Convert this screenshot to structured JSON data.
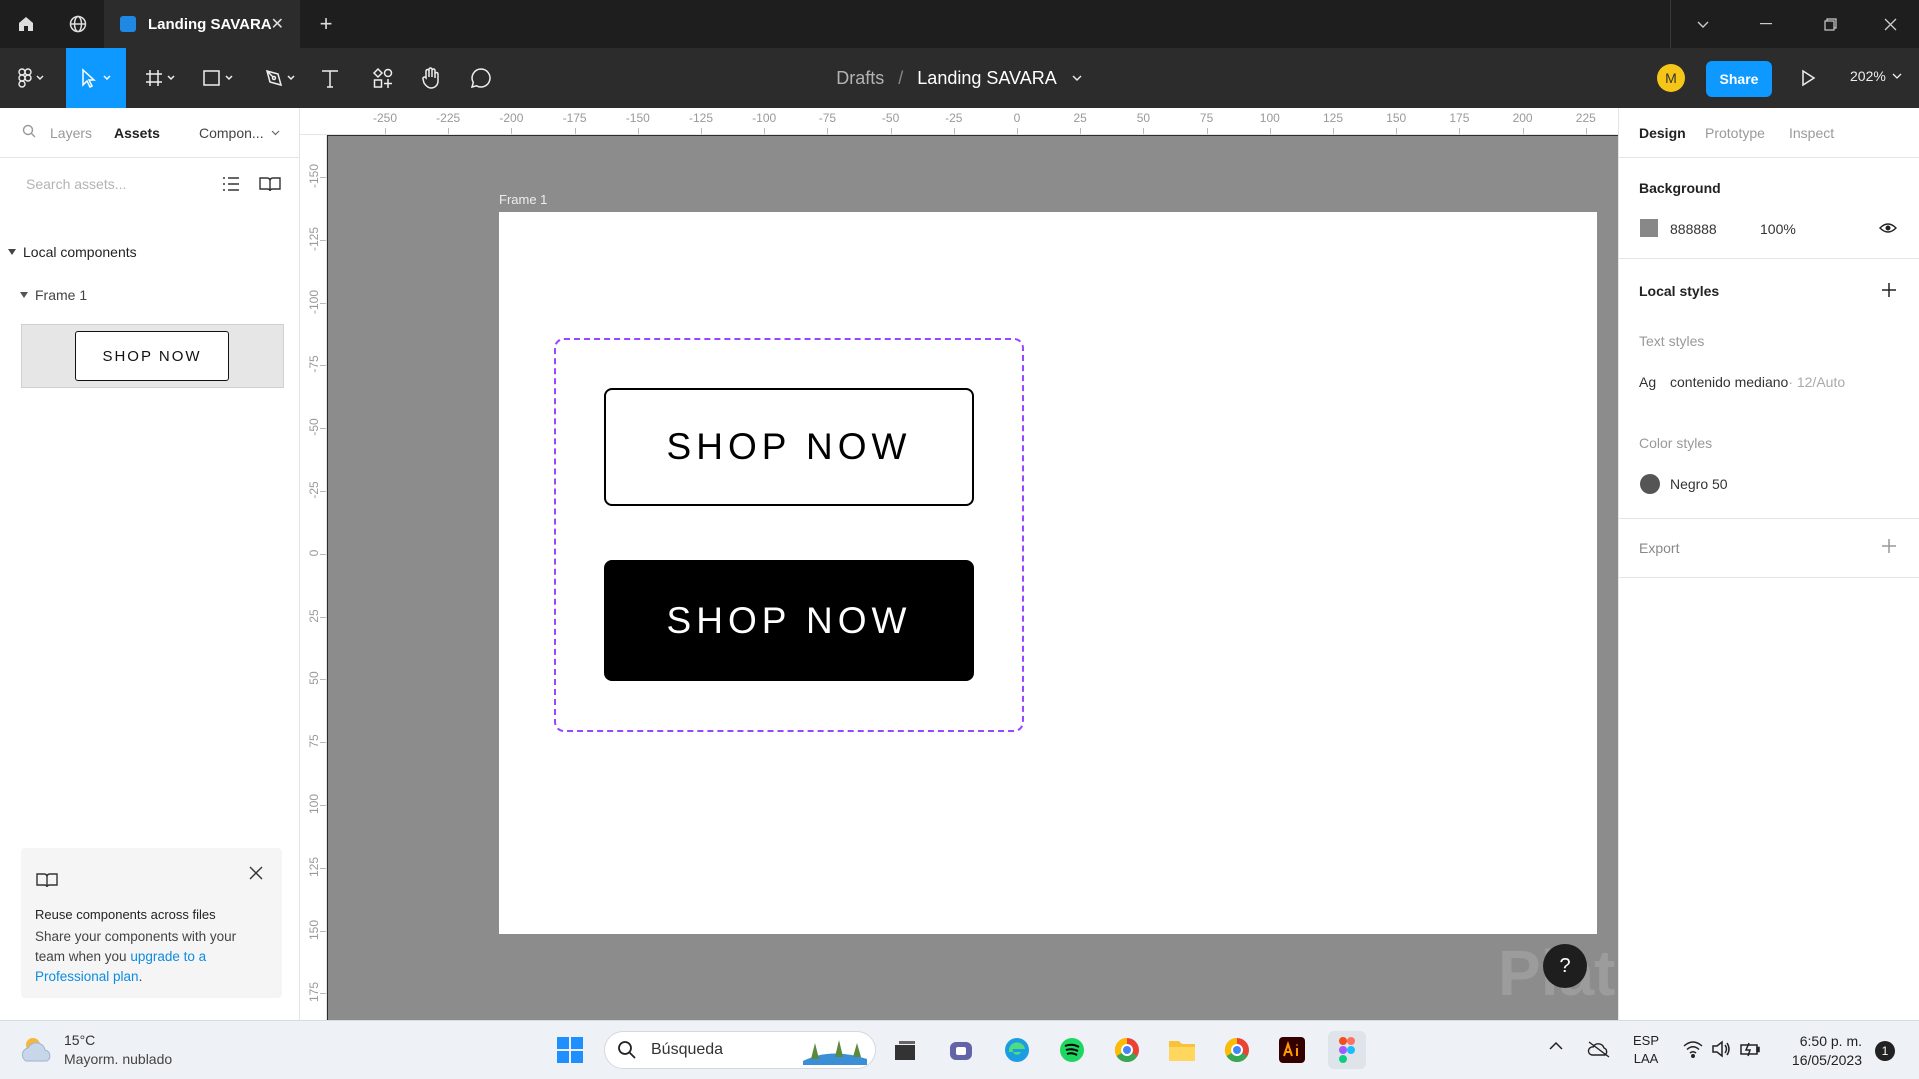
{
  "titlebar": {
    "tab_title": "Landing SAVARA",
    "close_glyph": "✕",
    "new_tab_glyph": "+"
  },
  "toolbar": {
    "breadcrumb_parent": "Drafts",
    "breadcrumb_sep": "/",
    "file_name": "Landing SAVARA",
    "avatar_initial": "M",
    "share_label": "Share",
    "zoom": "202%"
  },
  "left_panel": {
    "tabs": [
      "Layers",
      "Assets",
      "Compon..."
    ],
    "search_placeholder": "Search assets...",
    "section_local": "Local components",
    "group_frame": "Frame 1",
    "thumb_label": "SHOP NOW",
    "promo": {
      "title": "Reuse components across files",
      "body": "Share your components with your team when you ",
      "link": "upgrade to a Professional plan",
      "end": "."
    }
  },
  "rulers": {
    "top": [
      "-250",
      "-225",
      "-200",
      "-175",
      "-150",
      "-125",
      "-100",
      "-75",
      "-50",
      "-25",
      "0",
      "25",
      "50",
      "75",
      "100",
      "125",
      "150",
      "175",
      "200",
      "225"
    ],
    "left": [
      "-150",
      "-125",
      "-100",
      "-75",
      "-50",
      "-25",
      "0",
      "25",
      "50",
      "75",
      "100",
      "125",
      "150",
      "175"
    ]
  },
  "canvas": {
    "frame_label": "Frame 1",
    "button_outline": "SHOP NOW",
    "button_filled": "SHOP NOW",
    "help": "?",
    "watermark": "Platzi",
    "colors": {
      "canvas": "#8c8c8c",
      "variant_border": "#9747ff"
    }
  },
  "right_panel": {
    "tabs": [
      "Design",
      "Prototype",
      "Inspect"
    ],
    "background_title": "Background",
    "bg_hex": "888888",
    "bg_opacity": "100%",
    "bg_color": "#888888",
    "local_styles_title": "Local styles",
    "text_styles_title": "Text styles",
    "text_style_ag": "Ag",
    "text_style_name": "contenido mediano",
    "text_style_meta": " · 12/Auto",
    "color_styles_title": "Color styles",
    "color_style_name": "Negro 50",
    "color_style_color": "#555555",
    "export_title": "Export"
  },
  "taskbar": {
    "weather_temp": "15°C",
    "weather_desc": "Mayorm. nublado",
    "search_label": "Búsqueda",
    "lang_1": "ESP",
    "lang_2": "LAA",
    "time": "6:50 p. m.",
    "date": "16/05/2023",
    "notif_count": "1"
  }
}
